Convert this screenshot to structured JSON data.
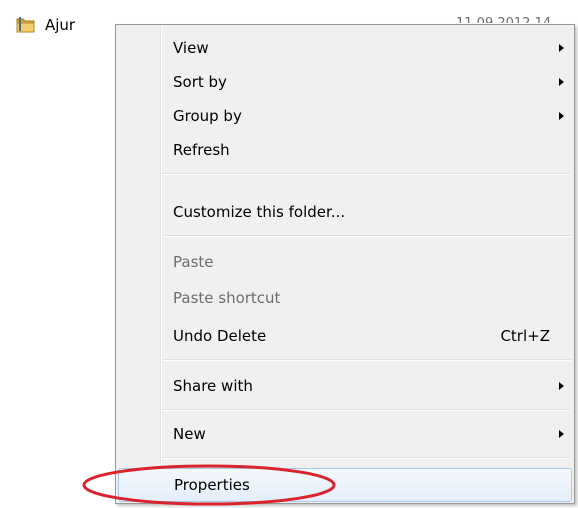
{
  "explorer": {
    "file_name": "Ajur",
    "file_date": "11.09.2012 14",
    "folder_icon": "folder-icon"
  },
  "context_menu": {
    "items": [
      {
        "label": "View",
        "submenu": true,
        "disabled": false
      },
      {
        "label": "Sort by",
        "submenu": true,
        "disabled": false
      },
      {
        "label": "Group by",
        "submenu": true,
        "disabled": false
      },
      {
        "label": "Refresh",
        "submenu": false,
        "disabled": false
      },
      {
        "label": "Customize this folder...",
        "submenu": false,
        "disabled": false
      },
      {
        "label": "Paste",
        "submenu": false,
        "disabled": true
      },
      {
        "label": "Paste shortcut",
        "submenu": false,
        "disabled": true
      },
      {
        "label": "Undo Delete",
        "shortcut": "Ctrl+Z",
        "submenu": false,
        "disabled": false
      },
      {
        "label": "Share with",
        "submenu": true,
        "disabled": false
      },
      {
        "label": "New",
        "submenu": true,
        "disabled": false
      },
      {
        "label": "Properties",
        "submenu": false,
        "disabled": false,
        "highlighted": true
      }
    ]
  },
  "annotation": {
    "color": "#d9232d",
    "target": "Properties"
  }
}
